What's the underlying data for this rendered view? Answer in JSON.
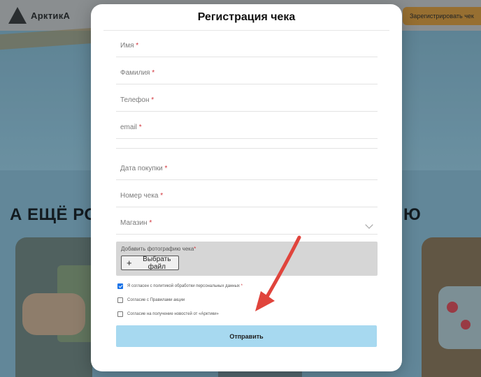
{
  "background": {
    "logo_text": "АрктикА",
    "register_button": "Зарегистрировать чек",
    "headline_left": "А ЕЩЁ РО",
    "headline_right": "Ю"
  },
  "modal": {
    "title": "Регистрация чека",
    "fields": [
      {
        "label": "Имя",
        "required": "*"
      },
      {
        "label": "Фамилия",
        "required": "*"
      },
      {
        "label": "Телефон",
        "required": "*"
      },
      {
        "label": "email",
        "required": "*"
      },
      {
        "label": "Дата покупки",
        "required": "*"
      },
      {
        "label": "Номер чека",
        "required": "*"
      },
      {
        "label": "Магазин",
        "required": "*"
      }
    ],
    "upload": {
      "label": "Добавить фотографию чека",
      "required": "*",
      "button": "Выбрать файл"
    },
    "checkboxes": [
      {
        "label": "Я согласен с политикой обработки персональных данных",
        "required": "*",
        "checked": true
      },
      {
        "label": "Согласие с Правилами акции",
        "required": "",
        "checked": false
      },
      {
        "label": "Согласие на получение новостей от «Арктики»",
        "required": "",
        "checked": false
      }
    ],
    "submit": "Отправить"
  },
  "colors": {
    "accent_submit": "#a7d9f0",
    "required": "#d2333a",
    "annotation_arrow": "#e0443c"
  }
}
